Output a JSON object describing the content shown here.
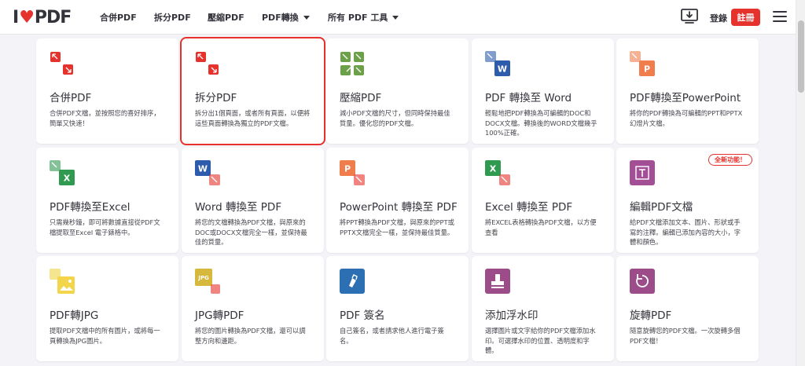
{
  "header": {
    "logo_left": "I",
    "logo_right": "PDF",
    "nav": [
      {
        "label": "合併PDF",
        "has_caret": false
      },
      {
        "label": "拆分PDF",
        "has_caret": false
      },
      {
        "label": "壓縮PDF",
        "has_caret": false
      },
      {
        "label": "PDF轉換",
        "has_caret": true
      },
      {
        "label": "所有 PDF 工具",
        "has_caret": true
      }
    ],
    "login_label": "登錄",
    "signup_label": "註冊"
  },
  "tools": [
    {
      "title": "合併PDF",
      "desc": "合併PDF文檔，並按照您的喜好排序，簡單又快速！",
      "icon": "merge-icon",
      "color": "#e5322d",
      "selected": false
    },
    {
      "title": "拆分PDF",
      "desc": "拆分出1個頁面，或者所有頁面，以便將這些頁面轉換為獨立的PDF文檔。",
      "icon": "split-icon",
      "color": "#e5322d",
      "selected": true
    },
    {
      "title": "壓縮PDF",
      "desc": "減小PDF文檔的尺寸，但同時保持最佳質量。優化您的PDF文檔。",
      "icon": "compress-icon",
      "color": "#6ca14a",
      "selected": false
    },
    {
      "title": "PDF 轉換至 Word",
      "desc": "輕鬆地把PDF轉換為可編輯的DOC和DOCX文檔。轉換後的WORD文檔幾乎100%正確。",
      "icon": "word-icon",
      "color": "#2c5cab",
      "selected": false
    },
    {
      "title": "PDF轉換至PowerPoint",
      "desc": "將你的PDF轉換為可編輯的PPT和PPTX幻燈片文檔。",
      "icon": "powerpoint-icon",
      "color": "#f07d4c",
      "selected": false
    },
    {
      "title": "PDF轉換至Excel",
      "desc": "只需幾秒鐘，即可將數據直接從PDF文檔提取至Excel 電子錶格中。",
      "icon": "excel-icon",
      "color": "#2f9a50",
      "selected": false
    },
    {
      "title": "Word 轉換至 PDF",
      "desc": "將您的文檔轉換為PDF文檔，與原來的DOC或DOCX文檔完全一樣，並保持最佳的質量。",
      "icon": "word-to-pdf-icon",
      "color": "#2c5cab",
      "selected": false
    },
    {
      "title": "PowerPoint 轉換至 PDF",
      "desc": "將PPT轉換為PDF文檔，與原來的PPT或PPTX文檔完全一樣，並保持最佳質量。",
      "icon": "powerpoint-to-pdf-icon",
      "color": "#f07d4c",
      "selected": false
    },
    {
      "title": "Excel 轉換至 PDF",
      "desc": "將EXCEL表格轉換為PDF文檔，以方便查看",
      "icon": "excel-to-pdf-icon",
      "color": "#2f9a50",
      "selected": false
    },
    {
      "title": "編輯PDF文檔",
      "desc": "給PDF文檔添加文本、圖片、形狀或手寫的注釋。編輯已添加內容的大小，字體和顏色。",
      "icon": "edit-icon",
      "color": "#a34f96",
      "selected": false,
      "badge": "全新功能！"
    },
    {
      "title": "PDF轉JPG",
      "desc": "提取PDF文檔中的所有圖片，或將每一頁轉換為JPG圖片。",
      "icon": "pdf-to-jpg-icon",
      "color": "#f2d54b",
      "selected": false
    },
    {
      "title": "JPG轉PDF",
      "desc": "將您的圖片轉換為PDF文檔，還可以調整方向和邊距。",
      "icon": "jpg-to-pdf-icon",
      "color": "#d6b83c",
      "selected": false
    },
    {
      "title": "PDF 簽名",
      "desc": "自己簽名，或者請求他人進行電子簽名。",
      "icon": "sign-icon",
      "color": "#2d6fb3",
      "selected": false
    },
    {
      "title": "添加浮水印",
      "desc": "選擇圖片或文字給你的PDF文檔添加水印。可選擇水印的位置、透明度和字體。",
      "icon": "watermark-icon",
      "color": "#9c4c89",
      "selected": false
    },
    {
      "title": "旋轉PDF",
      "desc": "隨意旋轉您的PDF文檔。一次旋轉多個PDF文檔！",
      "icon": "rotate-icon",
      "color": "#9c4c89",
      "selected": false
    }
  ]
}
